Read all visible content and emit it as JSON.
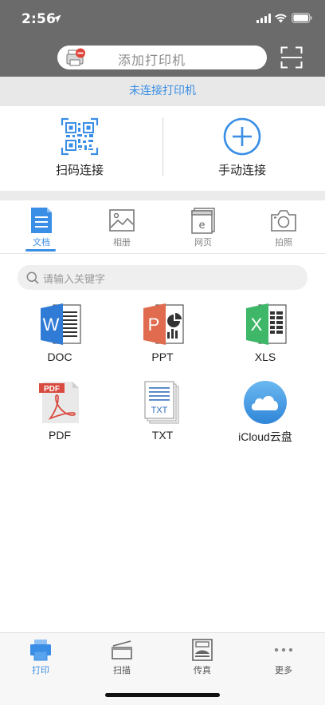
{
  "status_bar": {
    "time": "2:56"
  },
  "header": {
    "printer_search_placeholder": "添加打印机"
  },
  "banner": {
    "text": "未连接打印机"
  },
  "connect": {
    "qr_label": "扫码连接",
    "manual_label": "手动连接"
  },
  "tabs": [
    {
      "label": "文档",
      "icon": "document-icon",
      "active": true
    },
    {
      "label": "相册",
      "icon": "photo-icon",
      "active": false
    },
    {
      "label": "网页",
      "icon": "webpage-icon",
      "active": false
    },
    {
      "label": "拍照",
      "icon": "camera-icon",
      "active": false
    }
  ],
  "keyword_search": {
    "placeholder": "请输入关键字"
  },
  "files": [
    {
      "label": "DOC",
      "icon": "word-doc-icon"
    },
    {
      "label": "PPT",
      "icon": "powerpoint-icon"
    },
    {
      "label": "XLS",
      "icon": "excel-icon"
    },
    {
      "label": "PDF",
      "icon": "pdf-icon"
    },
    {
      "label": "TXT",
      "icon": "txt-icon"
    },
    {
      "label": "iCloud云盘",
      "icon": "icloud-icon"
    }
  ],
  "icon_text": {
    "word": "W",
    "ppt": "P",
    "xls": "X",
    "pdf": "PDF",
    "txt": "TXT"
  },
  "bottom_tabs": [
    {
      "label": "打印",
      "icon": "print-icon",
      "active": true
    },
    {
      "label": "扫描",
      "icon": "scan-icon",
      "active": false
    },
    {
      "label": "传真",
      "icon": "fax-icon",
      "active": false
    },
    {
      "label": "更多",
      "icon": "more-icon",
      "active": false
    }
  ],
  "colors": {
    "accent": "#3a8ee6",
    "header_bg": "#6b6b6b",
    "word": "#2f7bd6",
    "ppt": "#e06b4e",
    "xls": "#3fb768",
    "pdf": "#d94b40"
  }
}
